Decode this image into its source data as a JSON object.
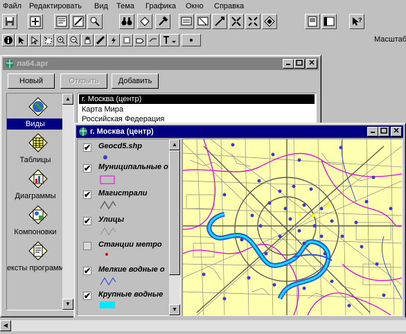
{
  "menu": [
    "Файл",
    "Редактировать",
    "Вид",
    "Тема",
    "Графика",
    "Окно",
    "Справка"
  ],
  "toolbar": {
    "scale_label": "Масштаб"
  },
  "project_window": {
    "title": "ла64.apr",
    "buttons": {
      "new": "Новый",
      "open": "Открыть",
      "add": "Добавить"
    },
    "doc_types": [
      {
        "label": "Виды",
        "icon": "globe-icon",
        "selected": true
      },
      {
        "label": "Таблицы",
        "icon": "table-icon",
        "selected": false
      },
      {
        "label": "Диаграммы",
        "icon": "chart-icon",
        "selected": false
      },
      {
        "label": "Компоновки",
        "icon": "layout-icon",
        "selected": false
      },
      {
        "label": "ексты программ",
        "icon": "script-icon",
        "selected": false
      }
    ],
    "documents": [
      "г. Москва (центр)",
      "Карта Мира",
      "Российская Федерация"
    ]
  },
  "view_window": {
    "title": "г. Москва (центр)",
    "themes": [
      {
        "name": "Geocd5.shp",
        "checked": true,
        "legend": "point",
        "color": "#3a3acc"
      },
      {
        "name": "Муниципальные о",
        "checked": true,
        "legend": "polygon",
        "color": "#e000e0"
      },
      {
        "name": "Магистрали",
        "checked": true,
        "legend": "line",
        "color": "#606060"
      },
      {
        "name": "Улицы",
        "checked": true,
        "legend": "line-thin",
        "color": "#909090"
      },
      {
        "name": "Станции метро",
        "checked": false,
        "legend": "point",
        "color": "#e00000"
      },
      {
        "name": "Мелкие водные о",
        "checked": true,
        "legend": "line",
        "color": "#2040e0"
      },
      {
        "name": "Крупные водные",
        "checked": true,
        "legend": "fill",
        "color": "#00e8ff"
      }
    ]
  },
  "colors": {
    "titlebar_active": "#000080",
    "titlebar_inactive": "#808080",
    "map_background": "#ffffb0",
    "district_border": "#e000e0",
    "river": "#3050e0",
    "point": "#3a3acc"
  }
}
